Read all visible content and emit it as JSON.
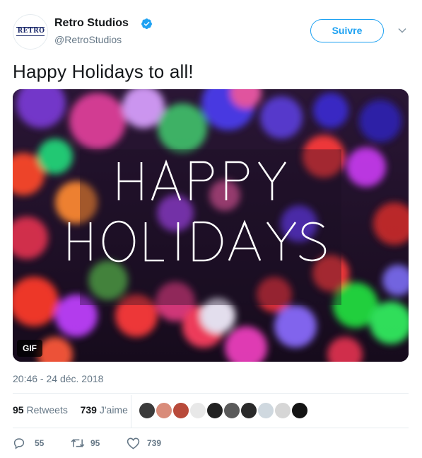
{
  "account": {
    "name": "Retro Studios",
    "handle": "@RetroStudios",
    "avatar_logo_text": "RETRO",
    "verified": true
  },
  "follow_button": {
    "label": "Suivre"
  },
  "tweet": {
    "text": "Happy Holidays to all!",
    "media": {
      "type": "gif",
      "badge": "GIF",
      "overlay_line1": "HAPPY",
      "overlay_line2": "HOLIDAYS"
    },
    "timestamp": "20:46 - 24 déc. 2018"
  },
  "stats": {
    "retweets_count": "95",
    "retweets_label": "Retweets",
    "likes_count": "739",
    "likes_label": "J'aime"
  },
  "liker_avatars": [
    {
      "color": "#3b3b3b"
    },
    {
      "color": "#d98c7a"
    },
    {
      "color": "#b84a3a"
    },
    {
      "color": "#e8e8e8"
    },
    {
      "color": "#222222"
    },
    {
      "color": "#5a5a5a"
    },
    {
      "color": "#2a2a2a"
    },
    {
      "color": "#cfd8df"
    },
    {
      "color": "#d6d6d6"
    },
    {
      "color": "#141414"
    }
  ],
  "actions": {
    "reply_count": "55",
    "retweet_count": "95",
    "like_count": "739"
  },
  "colors": {
    "accent": "#1da1f2",
    "secondary_text": "#657786",
    "divider": "#e6ecf0"
  },
  "icons": [
    "verified-badge-icon",
    "chevron-down-icon",
    "reply-icon",
    "retweet-icon",
    "like-icon"
  ]
}
